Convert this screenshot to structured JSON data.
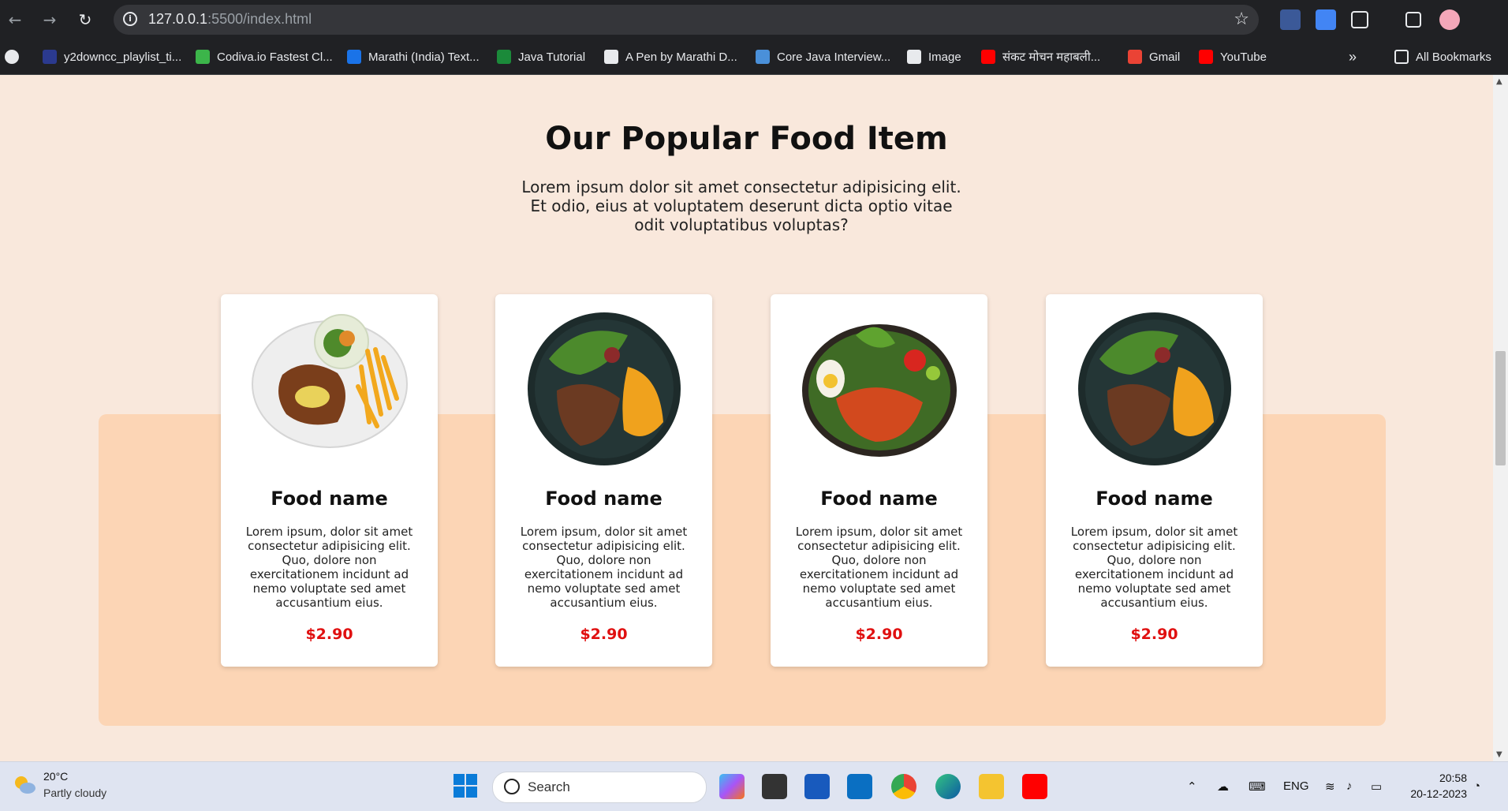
{
  "browser": {
    "url_host": "127.0.0.1",
    "url_rest": ":5500/index.html",
    "bookmarks": [
      {
        "label": "y2downcc_playlist_ti...",
        "color": "#2b3a8f"
      },
      {
        "label": "Codiva.io Fastest Cl...",
        "color": "#3cb54a"
      },
      {
        "label": "Marathi (India) Text...",
        "color": "#1a73e8"
      },
      {
        "label": "Java Tutorial",
        "color": "#1b8a3a"
      },
      {
        "label": "A Pen by Marathi D...",
        "color": "#e8eaed"
      },
      {
        "label": "Core Java Interview...",
        "color": "#4a90d9"
      },
      {
        "label": "Image",
        "color": "#e8eaed"
      },
      {
        "label": "संकट मोचन महाबली...",
        "color": "#ff0000"
      },
      {
        "label": "Gmail",
        "color": "#ea4335"
      },
      {
        "label": "YouTube",
        "color": "#ff0000"
      }
    ],
    "more_label": "»",
    "all_bookmarks": "All Bookmarks"
  },
  "page": {
    "title": "Our Popular Food Item",
    "subtitle": "Lorem ipsum dolor sit amet consectetur adipisicing elit. Et odio, eius at voluptatem deserunt dicta optio vitae odit voluptatibus voluptas?",
    "cards": [
      {
        "name": "Food name",
        "desc": "Lorem ipsum, dolor sit amet consectetur adipisicing elit. Quo, dolore non exercitationem incidunt ad nemo voluptate sed amet accusantium eius.",
        "price": "$2.90",
        "image": "steak-plate"
      },
      {
        "name": "Food name",
        "desc": "Lorem ipsum, dolor sit amet consectetur adipisicing elit. Quo, dolore non exercitationem incidunt ad nemo voluptate sed amet accusantium eius.",
        "price": "$2.90",
        "image": "dark-bowl"
      },
      {
        "name": "Food name",
        "desc": "Lorem ipsum, dolor sit amet consectetur adipisicing elit. Quo, dolore non exercitationem incidunt ad nemo voluptate sed amet accusantium eius.",
        "price": "$2.90",
        "image": "rice-bowl"
      },
      {
        "name": "Food name",
        "desc": "Lorem ipsum, dolor sit amet consectetur adipisicing elit. Quo, dolore non exercitationem incidunt ad nemo voluptate sed amet accusantium eius.",
        "price": "$2.90",
        "image": "dark-bowl"
      }
    ]
  },
  "taskbar": {
    "temp": "20°C",
    "weather": "Partly cloudy",
    "search": "Search",
    "lang": "ENG",
    "time": "20:58",
    "date": "20-12-2023"
  },
  "colors": {
    "accent": "#e01010",
    "background": "#f9e8dc",
    "band": "#fcd5b5"
  }
}
